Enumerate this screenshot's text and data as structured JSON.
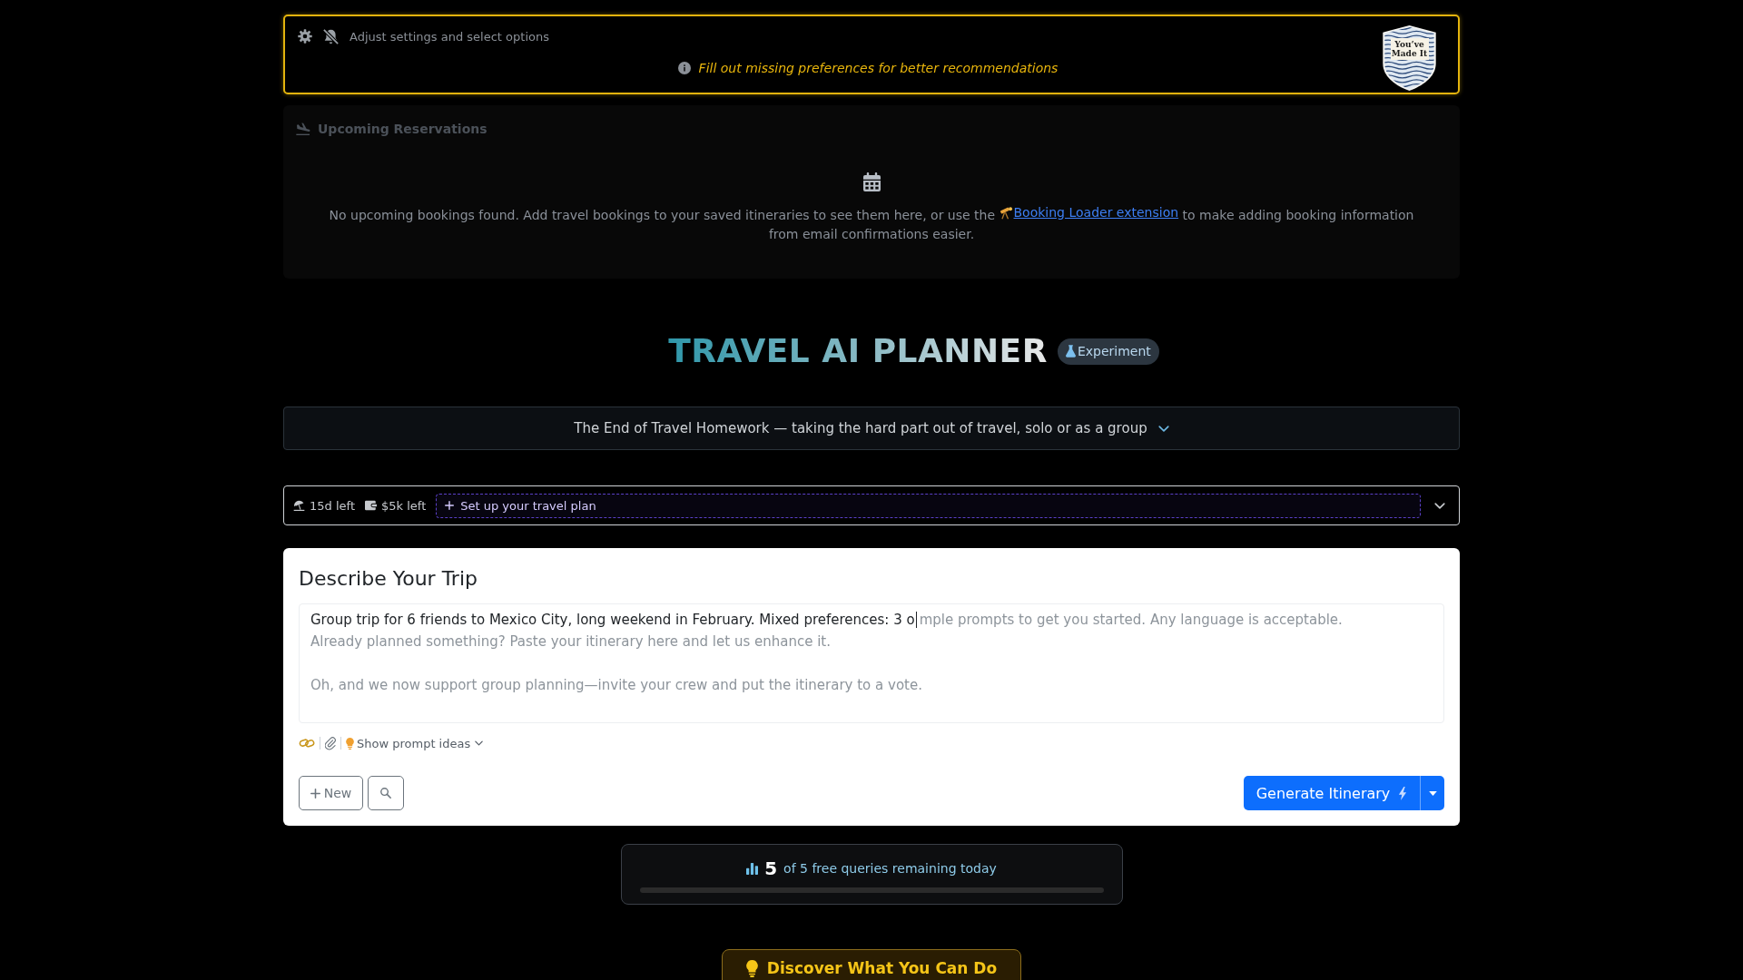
{
  "notice_banner": {
    "settings_label": "Adjust settings and select options",
    "notice": "Fill out missing preferences for better recommendations",
    "badge_title": "You’ve Made It"
  },
  "upcoming_reservations": {
    "title": "Upcoming Reservations",
    "message": {
      "before": "No upcoming bookings found. Add travel bookings to your saved itineraries to see them here, or use the",
      "link": "Booking Loader extension",
      "after": "to make adding booking information from email confirmations easier."
    }
  },
  "header": {
    "title": "TRAVEL AI PLANNER",
    "badge": "Experiment"
  },
  "tagline": "The End of Travel Homework — taking the hard part out of travel, solo or as a group",
  "plan_bar": {
    "stats": [
      {
        "kind": "days",
        "text": "15d left"
      },
      {
        "kind": "budget",
        "text": "$5k left"
      }
    ],
    "setup_button": "Set up your travel plan"
  },
  "trip_form": {
    "title": "Describe Your Trip",
    "description": {
      "value": "Group trip for 6 friends to Mexico City, long weekend in February. Mixed preferences: 3 o",
      "placeholder": "mple prompts to get you started. Any language is acceptable.\nAlready planned something? Paste your itinerary here and let us enhance it.\n\nOh, and we now support group planning—invite your crew and put the itinerary to a vote."
    },
    "prompt_ideas_button": "Show prompt ideas",
    "new_button": "New",
    "generate_button": "Generate Itinerary"
  },
  "queries": {
    "count": "5",
    "text": "of 5 free queries remaining today",
    "level": 0
  },
  "discover_button": "Discover What You Can Do"
}
